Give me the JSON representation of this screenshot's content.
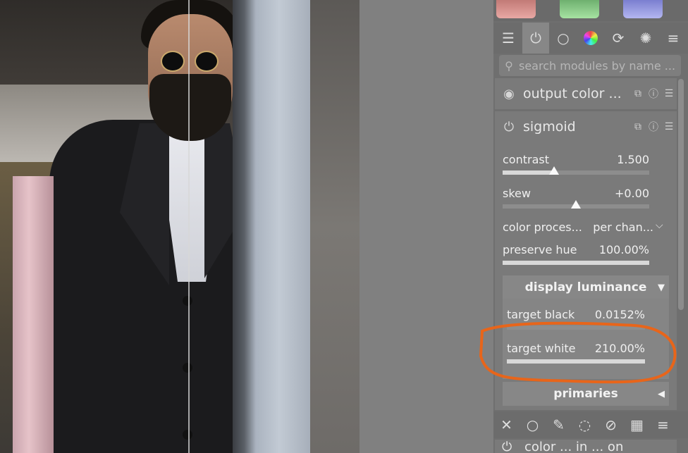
{
  "search": {
    "placeholder": "search modules by name ..."
  },
  "tabs": [
    {
      "icon": "sliders-icon"
    },
    {
      "icon": "power-icon"
    },
    {
      "icon": "circle-icon"
    },
    {
      "icon": "color-wheel-icon"
    },
    {
      "icon": "refresh-circle-icon"
    },
    {
      "icon": "palette-icon"
    },
    {
      "icon": "menu-icon"
    }
  ],
  "modules": {
    "output_color": {
      "name": "output color ..."
    },
    "sigmoid": {
      "name": "sigmoid"
    },
    "next": {
      "name": "color ... in ... on"
    }
  },
  "sigmoid": {
    "contrast": {
      "label": "contrast",
      "value": "1.500",
      "fraction": 0.35
    },
    "skew": {
      "label": "skew",
      "value": "+0.00",
      "fraction": 0.5
    },
    "color_processing": {
      "label": "color proces...",
      "value": "per chan..."
    },
    "preserve_hue": {
      "label": "preserve hue",
      "value": "100.00%",
      "fraction": 1.0
    },
    "display_luminance": {
      "title": "display luminance",
      "target_black": {
        "label": "target black",
        "value": "0.0152%",
        "fraction": 0.0
      },
      "target_white": {
        "label": "target white",
        "value": "210.00%",
        "fraction": 1.0
      }
    },
    "primaries": {
      "title": "primaries"
    }
  },
  "colors": {
    "annotation": "#e8651a",
    "panel": "#6f6f6f"
  }
}
